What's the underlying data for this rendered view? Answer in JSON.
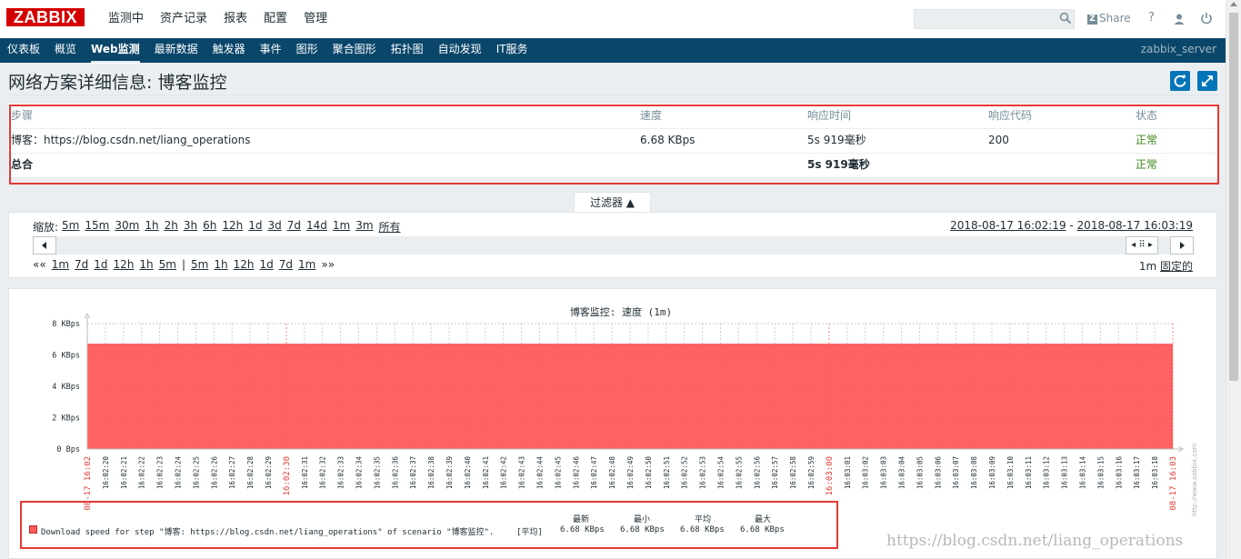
{
  "app": {
    "logo": "ZABBIX",
    "top_menu": [
      "监测中",
      "资产记录",
      "报表",
      "配置",
      "管理"
    ],
    "share_label": "Share",
    "help_label": "?",
    "server_name": "zabbix_server"
  },
  "sub_menu": [
    "仪表板",
    "概览",
    "Web监测",
    "最新数据",
    "触发器",
    "事件",
    "图形",
    "聚合图形",
    "拓扑图",
    "自动发现",
    "IT服务"
  ],
  "page": {
    "title": "网络方案详细信息: 博客监控"
  },
  "steps_table": {
    "headers": [
      "步骤",
      "速度",
      "响应时间",
      "响应代码",
      "状态"
    ],
    "rows": [
      [
        "博客：https://blog.csdn.net/liang_operations",
        "6.68 KBps",
        "5s 919毫秒",
        "200",
        "正常"
      ],
      [
        "总合",
        "",
        "5s 919毫秒",
        "",
        "正常"
      ]
    ]
  },
  "filter": {
    "tab_label": "过滤器 ▲",
    "zoom_label": "缩放:",
    "zoom_options": [
      "5m",
      "15m",
      "30m",
      "1h",
      "2h",
      "3h",
      "6h",
      "12h",
      "1d",
      "3d",
      "7d",
      "14d",
      "1m",
      "3m",
      "所有"
    ],
    "date_from": "2018-08-17 16:02:19",
    "date_sep": " - ",
    "date_to": "2018-08-17 16:03:19",
    "back_label": "««",
    "back_periods": [
      "1m",
      "7d",
      "1d",
      "12h",
      "1h",
      "5m"
    ],
    "sep": "|",
    "fwd_periods": [
      "5m",
      "1h",
      "12h",
      "1d",
      "7d",
      "1m"
    ],
    "fwd_label": "»»",
    "period_value": "1m",
    "fixed_label": "固定的"
  },
  "chart_data": {
    "type": "area",
    "title": "博客监控: 速度 (1m)",
    "ylim": [
      0,
      8
    ],
    "y_ticks": [
      "0 Bps",
      "2 KBps",
      "4 KBps",
      "6 KBps",
      "8 KBps"
    ],
    "x_ticks": [
      "08-17 16:02",
      "16:02:20",
      "16:02:21",
      "16:02:22",
      "16:02:23",
      "16:02:24",
      "16:02:25",
      "16:02:26",
      "16:02:27",
      "16:02:28",
      "16:02:29",
      "16:02:30",
      "16:02:31",
      "16:02:32",
      "16:02:33",
      "16:02:34",
      "16:02:35",
      "16:02:36",
      "16:02:37",
      "16:02:38",
      "16:02:39",
      "16:02:40",
      "16:02:41",
      "16:02:42",
      "16:02:43",
      "16:02:44",
      "16:02:45",
      "16:02:46",
      "16:02:47",
      "16:02:48",
      "16:02:49",
      "16:02:50",
      "16:02:51",
      "16:02:52",
      "16:02:53",
      "16:02:54",
      "16:02:55",
      "16:02:56",
      "16:02:57",
      "16:02:58",
      "16:02:59",
      "16:03:00",
      "16:03:01",
      "16:03:02",
      "16:03:03",
      "16:03:04",
      "16:03:05",
      "16:03:06",
      "16:03:07",
      "16:03:08",
      "16:03:09",
      "16:03:10",
      "16:03:11",
      "16:03:12",
      "16:03:13",
      "16:03:14",
      "16:03:15",
      "16:03:16",
      "16:03:17",
      "16:03:18",
      "08-17 16:03"
    ],
    "highlight_ticks": [
      "08-17 16:02",
      "16:02:30",
      "16:03:00",
      "08-17 16:03"
    ],
    "series": [
      {
        "name": "Download speed for step \"博客: https://blog.csdn.net/liang_operations\" of scenario \"博客监控\".",
        "value": 6.68,
        "color": "#ff5a5a"
      }
    ],
    "legend": {
      "func": "[平均]",
      "headers": [
        "最新",
        "最小",
        "平均",
        "最大"
      ],
      "values": [
        "6.68 KBps",
        "6.68 KBps",
        "6.68 KBps",
        "6.68 KBps"
      ]
    },
    "side_label": "http://www.zabbix.com"
  },
  "watermark": "https://blog.csdn.net/liang_operations"
}
